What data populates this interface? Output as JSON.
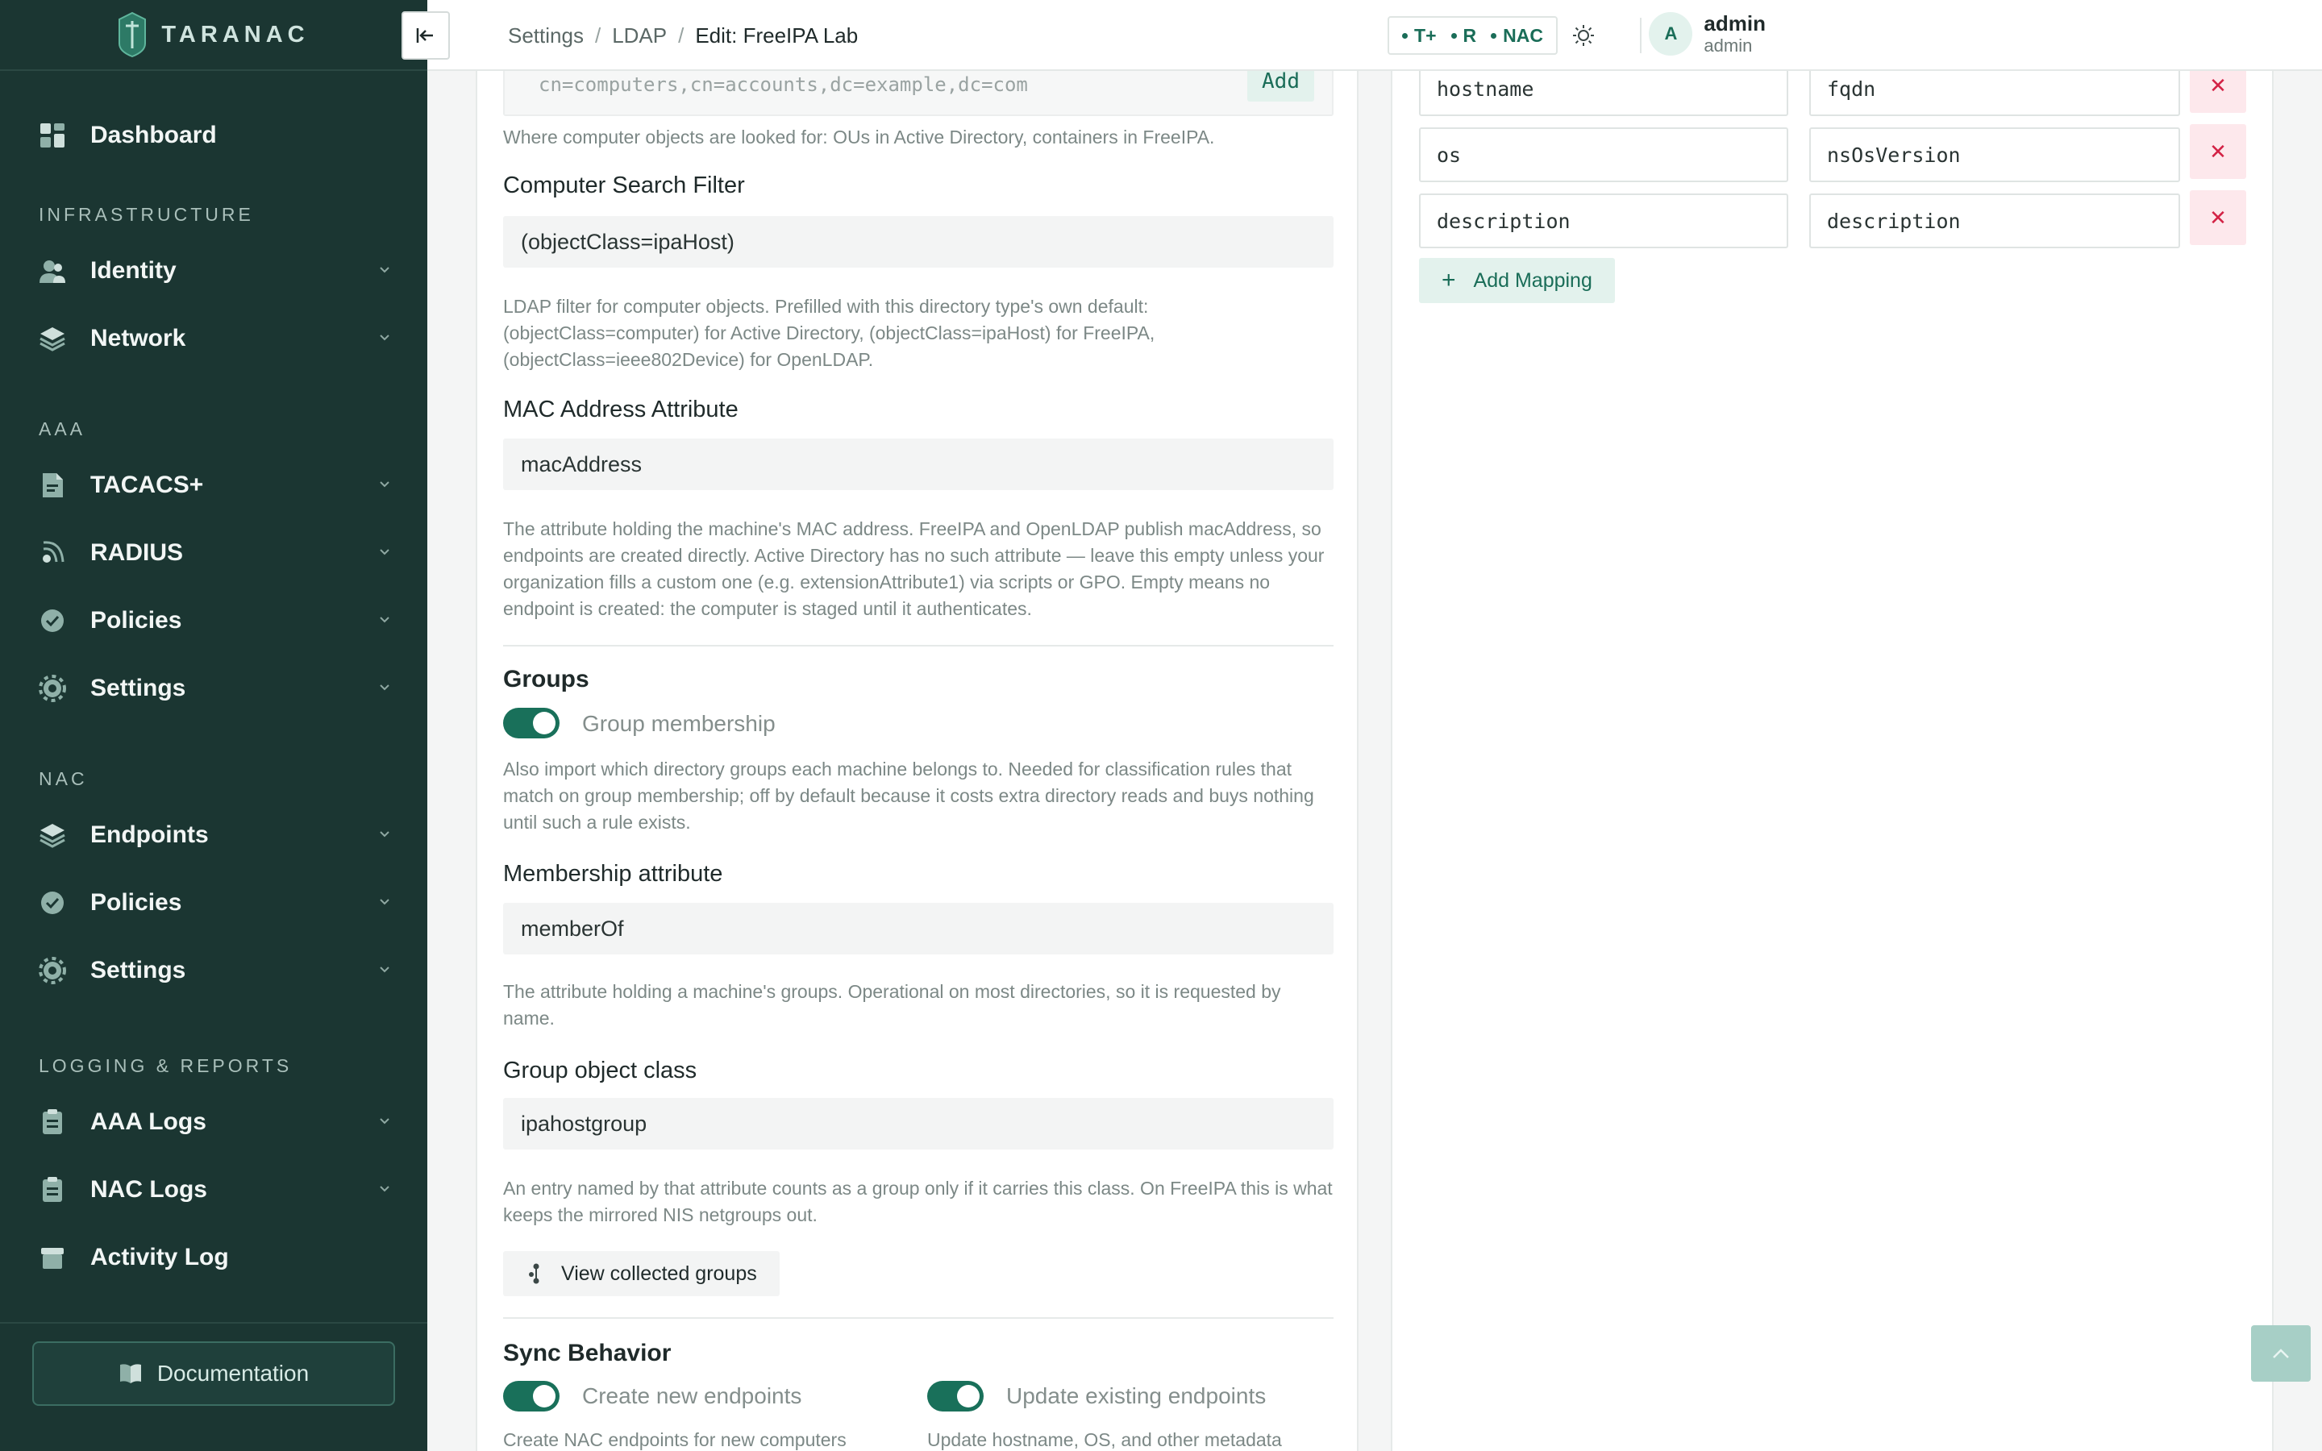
{
  "brand": {
    "name": "TARANAC"
  },
  "sidebar": {
    "items": {
      "dashboard": "Dashboard",
      "identity": "Identity",
      "network": "Network",
      "tacacs": "TACACS+",
      "radius": "RADIUS",
      "aaa_policies": "Policies",
      "aaa_settings": "Settings",
      "endpoints": "Endpoints",
      "nac_policies": "Policies",
      "nac_settings": "Settings",
      "aaa_logs": "AAA Logs",
      "nac_logs": "NAC Logs",
      "activity_log": "Activity Log"
    },
    "sections": {
      "infrastructure": "INFRASTRUCTURE",
      "aaa": "AAA",
      "nac": "NAC",
      "logging": "LOGGING & REPORTS"
    },
    "documentation": "Documentation"
  },
  "header": {
    "breadcrumb": [
      "Settings",
      "LDAP",
      "Edit: FreeIPA Lab"
    ],
    "separator": "/",
    "badges": [
      "T+",
      "R",
      "NAC"
    ],
    "user": {
      "initial": "A",
      "name": "admin",
      "role": "admin"
    }
  },
  "form": {
    "computer_base": {
      "placeholder": "cn=computers,cn=accounts,dc=example,dc=com",
      "add_label": "Add",
      "help": "Where computer objects are looked for: OUs in Active Directory, containers in FreeIPA."
    },
    "computer_filter": {
      "label": "Computer Search Filter",
      "value": "(objectClass=ipaHost)",
      "help": "LDAP filter for computer objects. Prefilled with this directory type's own default: (objectClass=computer) for Active Directory, (objectClass=ipaHost) for FreeIPA, (objectClass=ieee802Device) for OpenLDAP."
    },
    "mac_attribute": {
      "label": "MAC Address Attribute",
      "value": "macAddress",
      "help": "The attribute holding the machine's MAC address. FreeIPA and OpenLDAP publish macAddress, so endpoints are created directly. Active Directory has no such attribute — leave this empty unless your organization fills a custom one (e.g. extensionAttribute1) via scripts or GPO. Empty means no endpoint is created: the computer is staged until it authenticates."
    },
    "groups": {
      "heading": "Groups",
      "toggle_label": "Group membership",
      "toggle_on": true,
      "help": "Also import which directory groups each machine belongs to. Needed for classification rules that match on group membership; off by default because it costs extra directory reads and buys nothing until such a rule exists."
    },
    "membership_attribute": {
      "label": "Membership attribute",
      "value": "memberOf",
      "help": "The attribute holding a machine's groups. Operational on most directories, so it is requested by name."
    },
    "group_object_class": {
      "label": "Group object class",
      "value": "ipahostgroup",
      "help": "An entry named by that attribute counts as a group only if it carries this class. On FreeIPA this is what keeps the mirrored NIS netgroups out."
    },
    "view_groups_label": "View collected groups",
    "sync": {
      "heading": "Sync Behavior",
      "create_label": "Create new endpoints",
      "create_on": true,
      "create_help": "Create NAC endpoints for new computers",
      "update_label": "Update existing endpoints",
      "update_on": true,
      "update_help": "Update hostname, OS, and other metadata"
    }
  },
  "mappings": {
    "rows": [
      {
        "ldap": "hostname",
        "field": "fqdn"
      },
      {
        "ldap": "os",
        "field": "nsOsVersion"
      },
      {
        "ldap": "description",
        "field": "description"
      }
    ],
    "delete_glyph": "✕",
    "add_label": "Add Mapping",
    "add_glyph": "+"
  },
  "colors": {
    "sidebar_bg": "#1b3632",
    "accent": "#19705a",
    "danger": "#d32245"
  }
}
